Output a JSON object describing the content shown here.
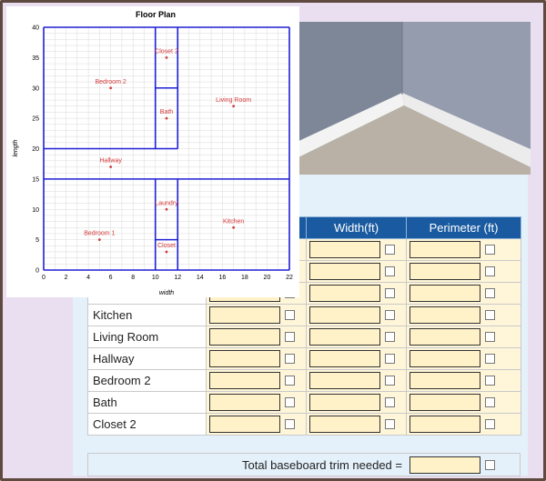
{
  "plot": {
    "title": "Floor Plan",
    "xlabel": "width",
    "ylabel": "length",
    "xticks": [
      "0",
      "2",
      "4",
      "6",
      "8",
      "10",
      "12",
      "14",
      "16",
      "18",
      "20",
      "22"
    ],
    "yticks": [
      "0",
      "5",
      "10",
      "15",
      "20",
      "25",
      "30",
      "35",
      "40"
    ],
    "rooms": [
      {
        "label": "Closet 2",
        "x": 11,
        "y": 35
      },
      {
        "label": "Bedroom 2",
        "x": 6,
        "y": 30
      },
      {
        "label": "Living Room",
        "x": 17,
        "y": 27
      },
      {
        "label": "Bath",
        "x": 11,
        "y": 25
      },
      {
        "label": "Hallway",
        "x": 6,
        "y": 17
      },
      {
        "label": "Laundry",
        "x": 11,
        "y": 10
      },
      {
        "label": "Kitchen",
        "x": 17,
        "y": 7
      },
      {
        "label": "Bedroom 1",
        "x": 5,
        "y": 5
      },
      {
        "label": "Closet",
        "x": 11,
        "y": 3
      }
    ],
    "walls": [
      [
        [
          0,
          0
        ],
        [
          22,
          0
        ]
      ],
      [
        [
          0,
          40
        ],
        [
          22,
          40
        ]
      ],
      [
        [
          0,
          0
        ],
        [
          0,
          40
        ]
      ],
      [
        [
          22,
          0
        ],
        [
          22,
          40
        ]
      ],
      [
        [
          0,
          15
        ],
        [
          22,
          15
        ]
      ],
      [
        [
          0,
          20
        ],
        [
          12,
          20
        ]
      ],
      [
        [
          10,
          0
        ],
        [
          10,
          15
        ]
      ],
      [
        [
          12,
          0
        ],
        [
          12,
          15
        ]
      ],
      [
        [
          10,
          20
        ],
        [
          10,
          40
        ]
      ],
      [
        [
          12,
          20
        ],
        [
          12,
          40
        ]
      ],
      [
        [
          10,
          5
        ],
        [
          12,
          5
        ]
      ],
      [
        [
          10,
          30
        ],
        [
          12,
          30
        ]
      ]
    ],
    "colors": {
      "wall": "#1f1fd6",
      "label": "#d43a3a",
      "grid": "#d9d9d9"
    }
  },
  "table": {
    "headers": [
      "",
      "",
      "Width(ft)",
      "Perimeter (ft)"
    ],
    "rows": [
      "",
      "",
      "",
      "Kitchen",
      "Living Room",
      "Hallway",
      "Bedroom 2",
      "Bath",
      "Closet 2"
    ]
  },
  "total_label": "Total baseboard trim needed ="
}
